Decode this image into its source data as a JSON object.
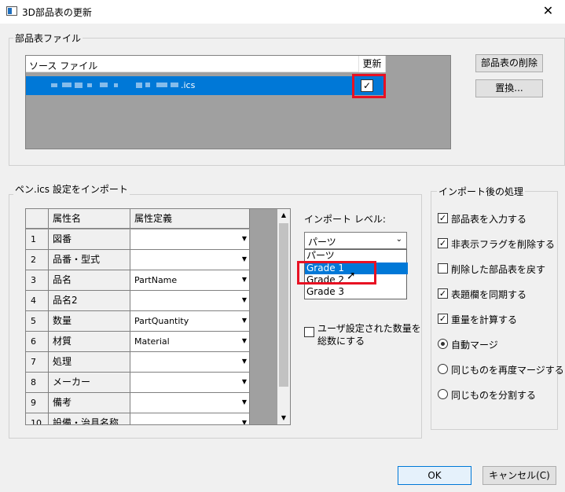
{
  "window": {
    "title": "3D部品表の更新",
    "close": "✕"
  },
  "bom_group": {
    "label": "部品表ファイル",
    "col_source": "ソース ファイル",
    "col_update": "更新",
    "file_suffix": ".ics",
    "update_checked": "✓",
    "delete_button": "部品表の削除",
    "replace_button": "置換..."
  },
  "import_group": {
    "label": "ペン.ics 設定をインポート",
    "grid": {
      "headers": [
        "属性名",
        "属性定義"
      ],
      "rows": [
        {
          "num": "1",
          "name": "図番",
          "def": ""
        },
        {
          "num": "2",
          "name": "品番・型式",
          "def": ""
        },
        {
          "num": "3",
          "name": "品名",
          "def": "PartName"
        },
        {
          "num": "4",
          "name": "品名2",
          "def": ""
        },
        {
          "num": "5",
          "name": "数量",
          "def": "PartQuantity"
        },
        {
          "num": "6",
          "name": "材質",
          "def": "Material"
        },
        {
          "num": "7",
          "name": "処理",
          "def": ""
        },
        {
          "num": "8",
          "name": "メーカー",
          "def": ""
        },
        {
          "num": "9",
          "name": "備考",
          "def": ""
        },
        {
          "num": "10",
          "name": "設備・治具名称",
          "def": ""
        }
      ]
    },
    "level_label": "インポート レベル:",
    "level_value": "パーツ",
    "level_options": [
      "パーツ",
      "Grade 1",
      "Grade 2",
      "Grade 3"
    ],
    "user_qty_line1": "ユーザ設定された数量を",
    "user_qty_line2": "総数にする"
  },
  "post_group": {
    "label": "インポート後の処理",
    "checks": [
      {
        "label": "部品表を入力する",
        "checked": "✓"
      },
      {
        "label": "非表示フラグを削除する",
        "checked": "✓"
      },
      {
        "label": "削除した部品表を戻す",
        "checked": ""
      },
      {
        "label": "表題欄を同期する",
        "checked": "✓"
      },
      {
        "label": "重量を計算する",
        "checked": "✓"
      }
    ],
    "radios": [
      {
        "label": "自動マージ"
      },
      {
        "label": "同じものを再度マージする"
      },
      {
        "label": "同じものを分割する"
      }
    ]
  },
  "footer": {
    "ok": "OK",
    "cancel": "キャンセル(C)"
  }
}
